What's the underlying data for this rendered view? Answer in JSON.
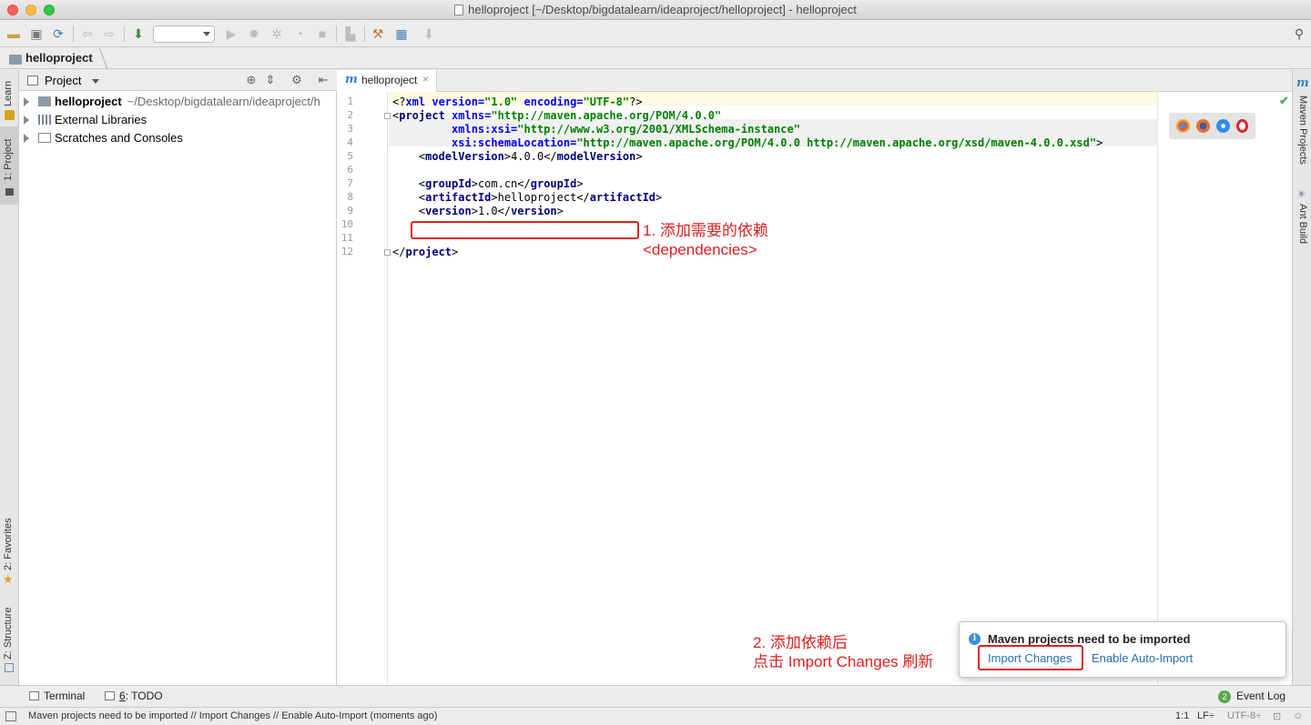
{
  "window": {
    "title": "helloproject [~/Desktop/bigdatalearn/ideaproject/helloproject] - helloproject"
  },
  "toolbar": {
    "icons": [
      "open-folder-icon",
      "save-icon",
      "sync-icon",
      "back-icon",
      "forward-icon",
      "build-icon",
      "run-icon",
      "debug-icon",
      "coverage-icon",
      "profile-icon",
      "stop-icon",
      "project-structure-icon",
      "settings-icon",
      "sdk-icon",
      "vcs-icon",
      "search-icon"
    ]
  },
  "navbar": {
    "crumb": "helloproject"
  },
  "left_tabs": {
    "learn": "Learn",
    "project": "1: Project",
    "favorites": "2: Favorites",
    "structure": "Z: Structure"
  },
  "right_tabs": {
    "maven_icon": "m",
    "maven": "Maven Projects",
    "ant": "Ant Build"
  },
  "project_panel": {
    "title": "Project",
    "tree": [
      {
        "label": "helloproject",
        "path": "~/Desktop/bigdatalearn/ideaproject/h",
        "bold": true
      },
      {
        "label": "External Libraries",
        "path": ""
      },
      {
        "label": "Scratches and Consoles",
        "path": ""
      }
    ]
  },
  "editor": {
    "tab": {
      "icon": "m",
      "name": "helloproject",
      "close": "×"
    },
    "line_numbers": [
      "1",
      "2",
      "3",
      "4",
      "5",
      "6",
      "7",
      "8",
      "9",
      "10",
      "11",
      "12"
    ],
    "lines": {
      "l1_a": "<?",
      "l1_b": "xml ",
      "l1_c": "version=",
      "l1_d": "\"1.0\"",
      "l1_e": " encoding=",
      "l1_f": "\"UTF-8\"",
      "l1_g": "?>",
      "l2_a": "<",
      "l2_b": "project ",
      "l2_c": "xmlns=",
      "l2_d": "\"http://maven.apache.org/POM/4.0.0\"",
      "l3_a": "         ",
      "l3_b": "xmlns:xsi=",
      "l3_c": "\"http://www.w3.org/2001/XMLSchema-instance\"",
      "l4_a": "         ",
      "l4_b": "xsi:schemaLocation=",
      "l4_c": "\"http://maven.apache.org/POM/4.0.0 http://maven.apache.org/xsd/maven-4.0.0.xsd\"",
      "l4_d": ">",
      "l5_tag": "modelVersion",
      "l5_val": "4.0.0",
      "l7_tag": "groupId",
      "l7_val": "com.cn",
      "l8_tag": "artifactId",
      "l8_val": "helloproject",
      "l9_tag": "version",
      "l9_val": "1.0",
      "l12_tag": "project"
    }
  },
  "annotations": {
    "step1_line1": "1. 添加需要的依赖",
    "step1_line2": "<dependencies>",
    "step2_line1": "2. 添加依赖后",
    "step2_line2": "点击 Import Changes 刷新"
  },
  "notification": {
    "title": "Maven projects need to be imported",
    "import_changes": "Import Changes",
    "enable_auto_import": "Enable Auto-Import"
  },
  "bottom_tools": {
    "terminal": "Terminal",
    "todo_num": "6",
    "todo": ": TODO",
    "event_log_count": "2",
    "event_log": "Event Log"
  },
  "status_bar": {
    "message": "Maven projects need to be imported // Import Changes // Enable Auto-Import (moments ago)",
    "position": "1:1",
    "line_sep": "LF÷",
    "encoding": "UTF-8÷"
  },
  "colors": {
    "accent_link": "#2470b3",
    "annotation_red": "#e02020",
    "xml_tag": "#000080",
    "xml_value": "#008000"
  }
}
